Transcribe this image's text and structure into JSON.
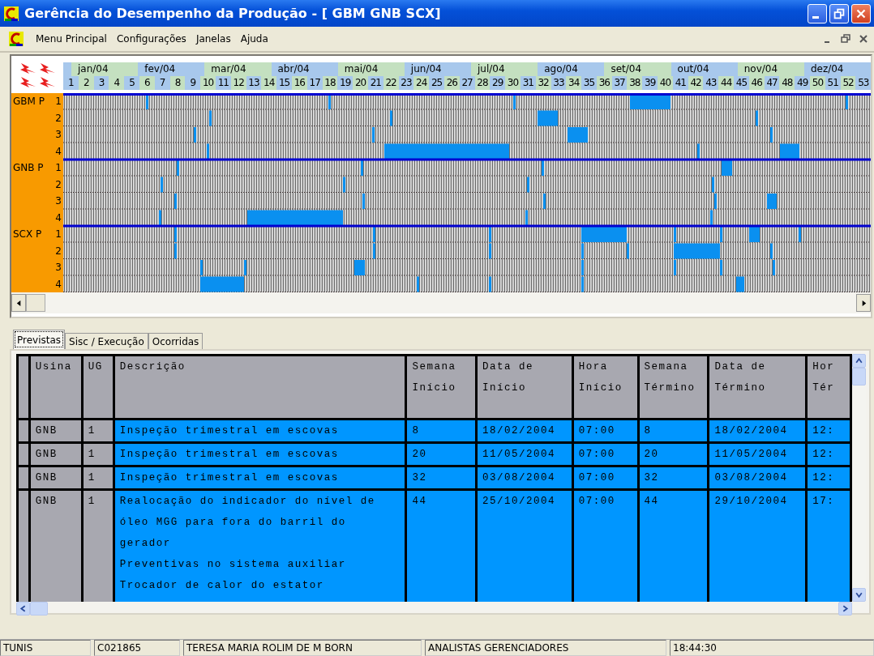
{
  "window": {
    "title": "Gerência do Desempenho da Produção - [ GBM GNB SCX]"
  },
  "menu": [
    "Menu Principal",
    "Configurações",
    "Janelas",
    "Ajuda"
  ],
  "timeline": {
    "months": [
      "jan/04",
      "fev/04",
      "mar/04",
      "abr/04",
      "mai/04",
      "jun/04",
      "jul/04",
      "ago/04",
      "set/04",
      "out/04",
      "nov/04",
      "dez/04"
    ],
    "weeks": [
      "1",
      "2",
      "3",
      "4",
      "5",
      "6",
      "7",
      "8",
      "9",
      "10",
      "11",
      "12",
      "13",
      "14",
      "15",
      "16",
      "17",
      "18",
      "19",
      "20",
      "21",
      "22",
      "23",
      "24",
      "25",
      "26",
      "27",
      "28",
      "29",
      "30",
      "31",
      "32",
      "33",
      "34",
      "35",
      "36",
      "37",
      "38",
      "39",
      "40",
      "41",
      "42",
      "43",
      "44",
      "45",
      "46",
      "47",
      "48",
      "49",
      "50",
      "51",
      "52",
      "53"
    ],
    "groups": [
      {
        "name": "GBM P",
        "units": [
          "1",
          "2",
          "3",
          "4"
        ]
      },
      {
        "name": "GNB P",
        "units": [
          "1",
          "2",
          "3",
          "4"
        ]
      },
      {
        "name": "SCX P",
        "units": [
          "1",
          "2",
          "3",
          "4"
        ]
      }
    ]
  },
  "tabs": [
    {
      "label": "Previstas",
      "selected": true
    },
    {
      "label": "Sisc / Execução",
      "selected": false
    },
    {
      "label": "Ocorridas",
      "selected": false
    }
  ],
  "table": {
    "columns": [
      {
        "label": "Usina"
      },
      {
        "label": "UG"
      },
      {
        "label": "Descrição"
      },
      {
        "label": "Semana\nInício"
      },
      {
        "label": "Data de\nInício"
      },
      {
        "label": "Hora\nInício"
      },
      {
        "label": "Semana\nTérmino"
      },
      {
        "label": "Data de\nTérmino"
      },
      {
        "label": "Hor\nTér"
      }
    ],
    "rows": [
      {
        "selected": true,
        "cells": [
          "GNB",
          "1",
          "Inspeção trimestral em escovas",
          "8",
          "18/02/2004",
          "07:00",
          "8",
          "18/02/2004",
          "12:"
        ]
      },
      {
        "selected": true,
        "cells": [
          "GNB",
          "1",
          "Inspeção trimestral em escovas",
          "20",
          "11/05/2004",
          "07:00",
          "20",
          "11/05/2004",
          "12:"
        ]
      },
      {
        "selected": true,
        "cells": [
          "GNB",
          "1",
          "Inspeção trimestral em escovas",
          "32",
          "03/08/2004",
          "07:00",
          "32",
          "03/08/2004",
          "12:"
        ]
      },
      {
        "selected": true,
        "cells": [
          "GNB",
          "1",
          "Realocação do indicador do nível de\nóleo MGG para fora do barril do\ngerador\nPreventivas no sistema auxiliar\nTrocador de calor do estator",
          "44",
          "25/10/2004",
          "07:00",
          "44",
          "29/10/2004",
          "17:"
        ]
      }
    ]
  },
  "status_bar": [
    "TUNIS",
    "C021865",
    "TERESA MARIA ROLIM DE M BORN",
    "ANALISTAS GERENCIADORES",
    "18:44:30"
  ]
}
